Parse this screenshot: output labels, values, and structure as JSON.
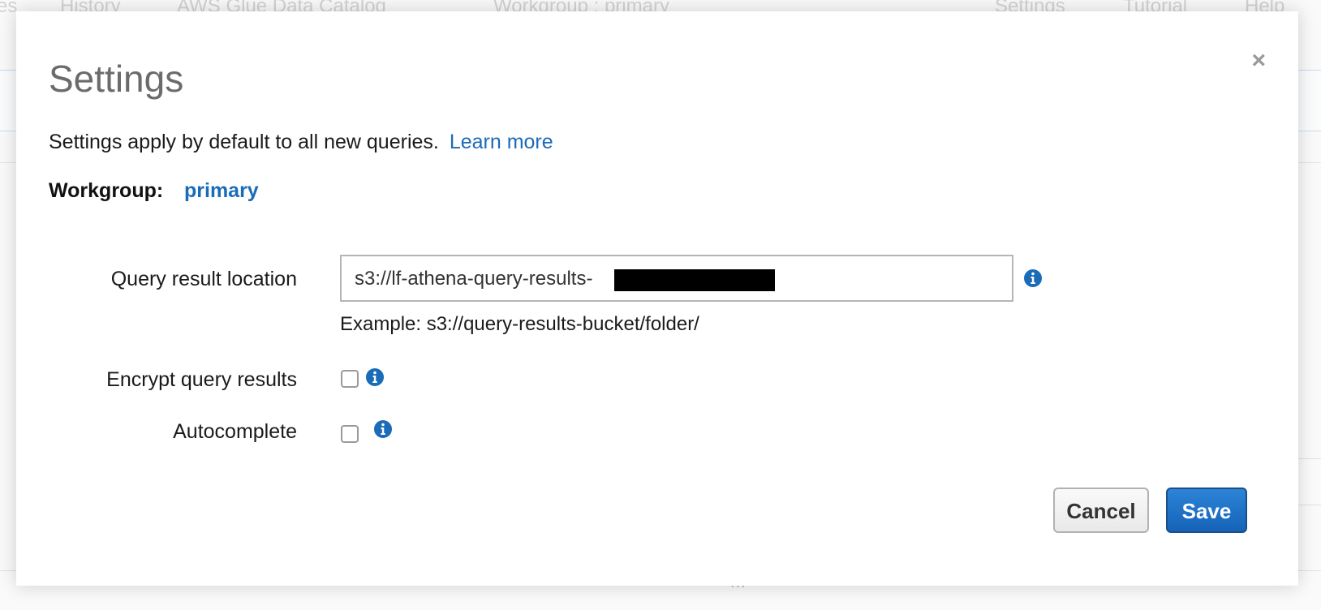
{
  "background": {
    "nav_items": [
      "es",
      "History",
      "AWS Glue Data Catalog",
      "Workgroup : primary",
      "Settings",
      "Tutorial",
      "Help"
    ],
    "dots": "..."
  },
  "modal": {
    "title": "Settings",
    "description": "Settings apply by default to all new queries.",
    "learn_more": "Learn more",
    "workgroup_label": "Workgroup:",
    "workgroup_value": "primary",
    "close_glyph": "×"
  },
  "query_result_location": {
    "label": "Query result location",
    "value": "s3://lf-athena-query-results-",
    "example": "Example: s3://query-results-bucket/folder/"
  },
  "encrypt_query_results": {
    "label": "Encrypt query results",
    "checked": false
  },
  "autocomplete": {
    "label": "Autocomplete",
    "checked": false
  },
  "buttons": {
    "cancel": "Cancel",
    "save": "Save"
  },
  "colors": {
    "link": "#1a6bb8",
    "primary_button": "#1a6fc4",
    "info_icon": "#1a6bb8"
  },
  "icons": {
    "info": "info-circle-icon",
    "close": "close-icon"
  }
}
